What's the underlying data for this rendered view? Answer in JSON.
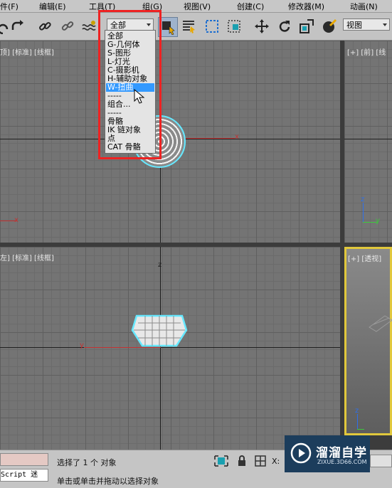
{
  "menubar": {
    "items": [
      "件(F)",
      "编辑(E)",
      "工具(T)",
      "组(G)",
      "视图(V)",
      "创建(C)",
      "修改器(M)",
      "动画(N)"
    ]
  },
  "toolbar": {
    "selection_filter_value": "全部",
    "view_dropdown_value": "视图"
  },
  "selection_filter_menu": {
    "items": [
      "全部",
      "G-几何体",
      "S-图形",
      "L-灯光",
      "C-摄影机",
      "H-辅助对象",
      "W-扭曲",
      "-----",
      "组合...",
      "-----",
      "骨骼",
      "IK 链对象",
      "点",
      "CAT 骨骼"
    ],
    "highlighted_item": "W-扭曲"
  },
  "viewports": {
    "top_left_label": "顶] [标准] [线框]",
    "top_right_label": "[+] [前] [线",
    "bottom_left_label": "左] [标准] [线框]",
    "bottom_right_label": "[+] [透视]"
  },
  "axes": {
    "x": "x",
    "y": "y",
    "z": "z"
  },
  "status": {
    "selected": "选择了 1 个 对象",
    "prompt": "单击或单击并拖动以选择对象",
    "maxscript": "Script 迷",
    "x_label": "X:"
  },
  "watermark": {
    "name": "溜溜自学",
    "url": "ZIXUE.3D66.COM"
  },
  "colors": {
    "highlight": "#3399ff",
    "annotation_box": "#ee2222",
    "active_viewport_border": "#e1c83c",
    "selection_outline": "#66e8ff"
  }
}
